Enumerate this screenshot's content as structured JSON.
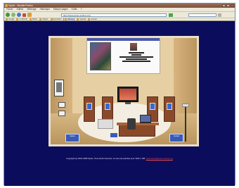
{
  "window": {
    "title": "Sylvie - Mozilla Firefox"
  },
  "menu": {
    "items": [
      "Fichier",
      "Edition",
      "Affichage",
      "Historique",
      "Marque-pages",
      "Outils",
      "?"
    ]
  },
  "toolbar": {
    "address": "http://www.sylvie.oneline.org/",
    "search_placeholder": ""
  },
  "bookmarks": {
    "items": [
      "Google",
      "Le Monde",
      "Météo",
      "Galerie",
      "Exposition",
      "Musée",
      "Agenda",
      "Accueil"
    ]
  },
  "page": {
    "signs": {
      "left": "Galerie",
      "right": "Contact"
    },
    "footer": {
      "copyright": "Copyright (c) 2001-2008 Sylvie. Tous droits réservés. Ce site est optimisé pour 1024 x 768.",
      "link": "webmaster@sylvie.oneline.org"
    }
  },
  "colors": {
    "page_bg": "#0c0c5c",
    "room_wall": "#e6cfa2",
    "link": "#e84a4a"
  }
}
